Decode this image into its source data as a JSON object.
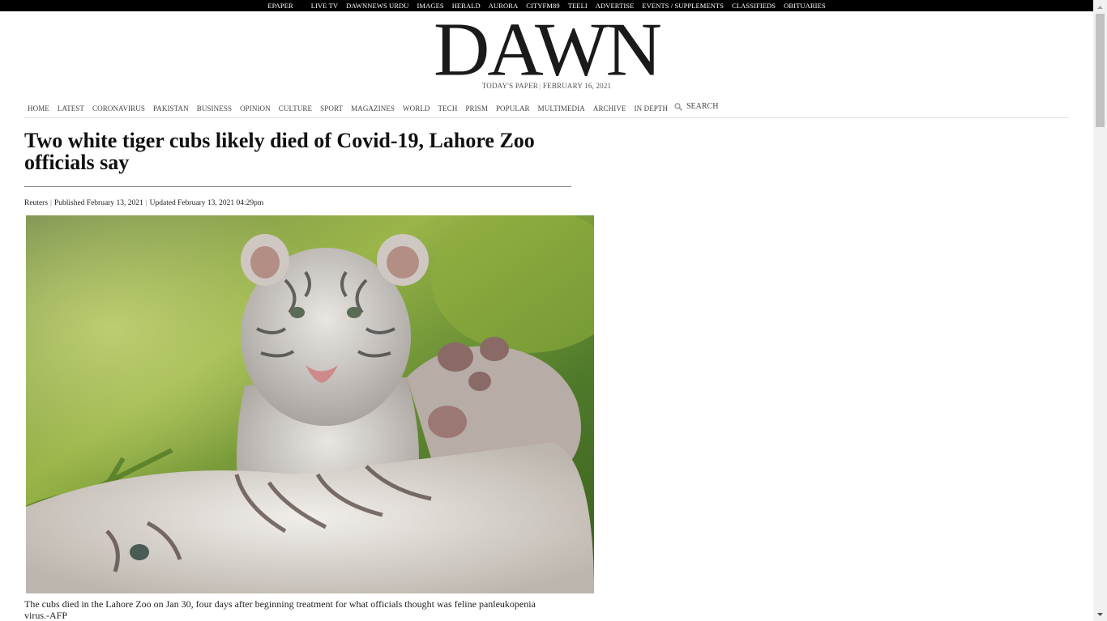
{
  "topbar": {
    "items": [
      "EPAPER",
      "LIVE TV",
      "DAWNNEWS URDU",
      "IMAGES",
      "HERALD",
      "AURORA",
      "CITYFM89",
      "TEELI",
      "ADVERTISE",
      "EVENTS / SUPPLEMENTS",
      "CLASSIFIEDS",
      "OBITUARIES"
    ]
  },
  "masthead": {
    "logo": "DAWN",
    "todays_paper": "TODAY'S PAPER",
    "separator": "|",
    "date": "FEBRUARY 16, 2021"
  },
  "nav": {
    "items": [
      "HOME",
      "LATEST",
      "CORONAVIRUS",
      "PAKISTAN",
      "BUSINESS",
      "OPINION",
      "CULTURE",
      "SPORT",
      "MAGAZINES",
      "WORLD",
      "TECH",
      "PRISM",
      "POPULAR",
      "MULTIMEDIA",
      "ARCHIVE",
      "IN DEPTH"
    ],
    "search_label": "SEARCH",
    "search_icon": "search-icon"
  },
  "article": {
    "headline": "Two white tiger cubs likely died of Covid-19, Lahore Zoo officials say",
    "source": "Reuters",
    "separator": "|",
    "published": "Published February 13, 2021",
    "updated": "Updated February 13, 2021 04:29pm",
    "caption": "The cubs died in the Lahore Zoo on Jan 30, four days after beginning treatment for what officials thought was feline panleukopenia virus.-AFP"
  },
  "colors": {
    "topbar_bg": "#000000",
    "text": "#111111",
    "nav_text": "#444444"
  }
}
